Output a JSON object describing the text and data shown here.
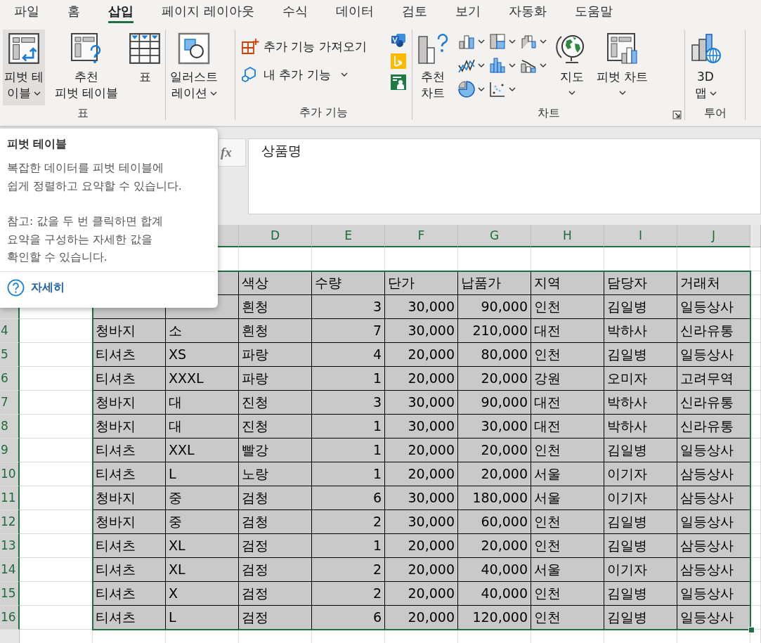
{
  "tabs": [
    {
      "label": "파일",
      "selected": false
    },
    {
      "label": "홈",
      "selected": false
    },
    {
      "label": "삽입",
      "selected": true
    },
    {
      "label": "페이지 레이아웃",
      "selected": false
    },
    {
      "label": "수식",
      "selected": false
    },
    {
      "label": "데이터",
      "selected": false
    },
    {
      "label": "검토",
      "selected": false
    },
    {
      "label": "보기",
      "selected": false
    },
    {
      "label": "자동화",
      "selected": false
    },
    {
      "label": "도움말",
      "selected": false
    }
  ],
  "ribbon": {
    "groups": [
      {
        "label": "표",
        "items": [
          {
            "kind": "large",
            "lines": [
              "피벗 테",
              "이블"
            ],
            "dropdown": true,
            "highlighted": true
          },
          {
            "kind": "large",
            "lines": [
              "추천",
              "피벗 테이블"
            ],
            "dropdown": false,
            "highlighted": false
          },
          {
            "kind": "large",
            "lines": [
              "표"
            ],
            "dropdown": false,
            "highlighted": false
          }
        ]
      },
      {
        "items": [
          {
            "kind": "large",
            "lines": [
              "일러스트",
              "레이션"
            ],
            "dropdown": true,
            "highlighted": false
          }
        ]
      },
      {
        "label": "추가 기능",
        "items": [
          {
            "kind": "row",
            "label": "추가 기능 가져오기",
            "dropdown": false
          },
          {
            "kind": "row",
            "label": "내 추가 기능",
            "dropdown": true
          },
          {
            "kind": "icon"
          },
          {
            "kind": "icon"
          },
          {
            "kind": "icon"
          }
        ]
      },
      {
        "label": "차트",
        "dialog_launcher": true,
        "items": [
          {
            "kind": "large",
            "lines": [
              "추천",
              "차트"
            ],
            "dropdown": false,
            "highlighted": false
          },
          {
            "kind": "small",
            "dropdown": true
          },
          {
            "kind": "small",
            "dropdown": true
          },
          {
            "kind": "small",
            "dropdown": true
          },
          {
            "kind": "small",
            "dropdown": true
          },
          {
            "kind": "small",
            "dropdown": true
          },
          {
            "kind": "small",
            "dropdown": true
          },
          {
            "kind": "small",
            "dropdown": true
          },
          {
            "kind": "small",
            "dropdown": true
          },
          {
            "kind": "large",
            "lines": [
              "지도"
            ],
            "dropdown": true,
            "highlighted": false
          },
          {
            "kind": "large",
            "lines": [
              "피벗 차트"
            ],
            "dropdown": true,
            "highlighted": false
          }
        ]
      },
      {
        "label": "투어",
        "items": [
          {
            "kind": "large",
            "lines": [
              "3D",
              "맵"
            ],
            "dropdown": true,
            "highlighted": false
          }
        ]
      }
    ]
  },
  "formula_bar": {
    "fx": "fx",
    "value": "상품명"
  },
  "tooltip": {
    "title": "피벗 테이블",
    "paragraphs": [
      [
        "복잡한 데이터를 피벗 테이블에",
        "쉽게 정렬하고 요약할 수 있습니다."
      ],
      [
        "참고: 값을 두 번 클릭하면 합계",
        "요약을 구성하는 자세한 값을",
        "확인할 수 있습니다."
      ]
    ],
    "link": "자세히"
  },
  "sheet": {
    "columns": [
      {},
      {},
      {
        "label": "D",
        "selected": true
      },
      {
        "label": "E",
        "selected": true
      },
      {
        "label": "F",
        "selected": true
      },
      {
        "label": "G",
        "selected": true
      },
      {
        "label": "H",
        "selected": true
      },
      {
        "label": "I",
        "selected": true
      },
      {
        "label": "J",
        "selected": true
      }
    ],
    "rows": [
      {
        "kind": "header",
        "cells": [
          "",
          "",
          "색상",
          "수량",
          "단가",
          "납품가",
          "지역",
          "담당자",
          "거래처"
        ]
      },
      {
        "kind": "data",
        "cells": [
          "",
          "",
          "흰청",
          "3",
          "30,000",
          "90,000",
          "인천",
          "김일병",
          "일등상사"
        ]
      },
      {
        "kind": "data",
        "number": "4",
        "selected": true,
        "cells": [
          "청바지",
          "소",
          "흰청",
          "7",
          "30,000",
          "210,000",
          "대전",
          "박하사",
          "신라유통"
        ]
      },
      {
        "kind": "data",
        "number": "5",
        "selected": true,
        "cells": [
          "티셔츠",
          "XS",
          "파랑",
          "4",
          "20,000",
          "80,000",
          "인천",
          "김일병",
          "일등상사"
        ]
      },
      {
        "kind": "data",
        "number": "6",
        "selected": true,
        "cells": [
          "티셔츠",
          "XXXL",
          "파랑",
          "1",
          "20,000",
          "20,000",
          "강원",
          "오미자",
          "고려무역"
        ]
      },
      {
        "kind": "data",
        "number": "7",
        "selected": true,
        "cells": [
          "청바지",
          "대",
          "진청",
          "3",
          "30,000",
          "90,000",
          "대전",
          "박하사",
          "신라유통"
        ]
      },
      {
        "kind": "data",
        "number": "8",
        "selected": true,
        "cells": [
          "청바지",
          "대",
          "진청",
          "1",
          "30,000",
          "30,000",
          "대전",
          "박하사",
          "신라유통"
        ]
      },
      {
        "kind": "data",
        "number": "9",
        "selected": true,
        "cells": [
          "티셔츠",
          "XXL",
          "빨강",
          "1",
          "20,000",
          "20,000",
          "인천",
          "김일병",
          "일등상사"
        ]
      },
      {
        "kind": "data",
        "number": "10",
        "selected": true,
        "cells": [
          "티셔츠",
          "L",
          "노랑",
          "1",
          "20,000",
          "20,000",
          "서울",
          "이기자",
          "삼등상사"
        ]
      },
      {
        "kind": "data",
        "number": "11",
        "selected": true,
        "cells": [
          "청바지",
          "중",
          "검청",
          "6",
          "30,000",
          "180,000",
          "서울",
          "이기자",
          "삼등상사"
        ]
      },
      {
        "kind": "data",
        "number": "12",
        "selected": true,
        "cells": [
          "청바지",
          "중",
          "검청",
          "2",
          "30,000",
          "60,000",
          "인천",
          "김일병",
          "일등상사"
        ]
      },
      {
        "kind": "data",
        "number": "13",
        "selected": true,
        "cells": [
          "티셔츠",
          "XL",
          "검정",
          "1",
          "20,000",
          "20,000",
          "인천",
          "김일병",
          "삼등상사"
        ]
      },
      {
        "kind": "data",
        "number": "14",
        "selected": true,
        "cells": [
          "티셔츠",
          "XL",
          "검정",
          "2",
          "20,000",
          "40,000",
          "서울",
          "이기자",
          "삼등상사"
        ]
      },
      {
        "kind": "data",
        "number": "15",
        "selected": true,
        "cells": [
          "티셔츠",
          "X",
          "검정",
          "2",
          "20,000",
          "40,000",
          "인천",
          "김일병",
          "일등상사"
        ]
      },
      {
        "kind": "data",
        "number": "16",
        "selected": true,
        "cells": [
          "티셔츠",
          "L",
          "검정",
          "6",
          "20,000",
          "120,000",
          "인천",
          "김일병",
          "일등상사"
        ]
      }
    ]
  }
}
